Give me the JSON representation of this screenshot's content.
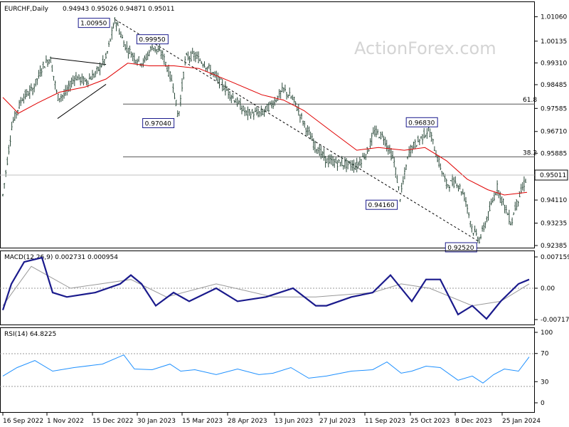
{
  "header": {
    "symbol_label": "EURCHF,Daily",
    "ohlc": "0.94943 0.95026 0.94871 0.95011",
    "watermark": "ActionForex.com"
  },
  "chart_data": [
    {
      "type": "candlestick",
      "title": "EURCHF,Daily",
      "ylim": [
        0.92385,
        1.0121
      ],
      "y_ticks": [
        "1.01060",
        "1.00135",
        "0.99310",
        "0.98485",
        "0.97585",
        "0.96710",
        "0.95885",
        "0.95011",
        "0.94110",
        "0.93235",
        "0.92385"
      ],
      "x_ticks": [
        "16 Sep 2022",
        "1 Nov 2022",
        "15 Dec 2022",
        "30 Jan 2023",
        "15 Mar 2023",
        "28 Apr 2023",
        "13 Jun 2023",
        "27 Jul 2023",
        "11 Sep 2023",
        "25 Oct 2023",
        "8 Dec 2023",
        "25 Jan 2024"
      ],
      "last_price_label": "0.95011",
      "price_path": [
        [
          "2022-09-16",
          0.943
        ],
        [
          "2022-09-25",
          0.97
        ],
        [
          "2022-10-05",
          0.98
        ],
        [
          "2022-10-15",
          0.983
        ],
        [
          "2022-10-25",
          0.992
        ],
        [
          "2022-11-01",
          0.995
        ],
        [
          "2022-11-08",
          0.98
        ],
        [
          "2022-11-15",
          0.981
        ],
        [
          "2022-11-25",
          0.988
        ],
        [
          "2022-12-05",
          0.986
        ],
        [
          "2022-12-15",
          0.989
        ],
        [
          "2022-12-25",
          0.995
        ],
        [
          "2023-01-03",
          1.0095
        ],
        [
          "2023-01-12",
          1.0
        ],
        [
          "2023-01-22",
          0.995
        ],
        [
          "2023-01-30",
          0.993
        ],
        [
          "2023-02-08",
          0.9995
        ],
        [
          "2023-02-18",
          0.996
        ],
        [
          "2023-02-28",
          0.985
        ],
        [
          "2023-03-05",
          0.972
        ],
        [
          "2023-03-12",
          0.995
        ],
        [
          "2023-03-20",
          0.996
        ],
        [
          "2023-03-30",
          0.993
        ],
        [
          "2023-04-10",
          0.988
        ],
        [
          "2023-04-25",
          0.981
        ],
        [
          "2023-05-10",
          0.974
        ],
        [
          "2023-05-25",
          0.974
        ],
        [
          "2023-06-05",
          0.978
        ],
        [
          "2023-06-15",
          0.983
        ],
        [
          "2023-06-25",
          0.979
        ],
        [
          "2023-07-05",
          0.97
        ],
        [
          "2023-07-15",
          0.962
        ],
        [
          "2023-07-27",
          0.956
        ],
        [
          "2023-08-10",
          0.955
        ],
        [
          "2023-08-25",
          0.954
        ],
        [
          "2023-09-05",
          0.96
        ],
        [
          "2023-09-11",
          0.967
        ],
        [
          "2023-09-20",
          0.965
        ],
        [
          "2023-09-30",
          0.956
        ],
        [
          "2023-10-06",
          0.942
        ],
        [
          "2023-10-15",
          0.96
        ],
        [
          "2023-10-25",
          0.964
        ],
        [
          "2023-11-03",
          0.968
        ],
        [
          "2023-11-12",
          0.956
        ],
        [
          "2023-11-20",
          0.947
        ],
        [
          "2023-11-30",
          0.948
        ],
        [
          "2023-12-08",
          0.942
        ],
        [
          "2023-12-15",
          0.93
        ],
        [
          "2023-12-22",
          0.926
        ],
        [
          "2023-12-30",
          0.935
        ],
        [
          "2024-01-08",
          0.946
        ],
        [
          "2024-01-15",
          0.939
        ],
        [
          "2024-01-22",
          0.932
        ],
        [
          "2024-01-25",
          0.938
        ],
        [
          "2024-02-01",
          0.945
        ],
        [
          "2024-02-06",
          0.9501
        ]
      ],
      "moving_average_path": [
        [
          "2022-09-16",
          0.98
        ],
        [
          "2022-10-01",
          0.974
        ],
        [
          "2022-10-20",
          0.978
        ],
        [
          "2022-11-10",
          0.982
        ],
        [
          "2022-12-05",
          0.984
        ],
        [
          "2022-12-25",
          0.987
        ],
        [
          "2023-01-15",
          0.993
        ],
        [
          "2023-02-05",
          0.992
        ],
        [
          "2023-03-01",
          0.992
        ],
        [
          "2023-03-25",
          0.991
        ],
        [
          "2023-04-25",
          0.986
        ],
        [
          "2023-05-25",
          0.981
        ],
        [
          "2023-06-15",
          0.979
        ],
        [
          "2023-07-05",
          0.975
        ],
        [
          "2023-08-01",
          0.967
        ],
        [
          "2023-08-25",
          0.96
        ],
        [
          "2023-09-15",
          0.961
        ],
        [
          "2023-10-10",
          0.96
        ],
        [
          "2023-10-30",
          0.961
        ],
        [
          "2023-11-20",
          0.956
        ],
        [
          "2023-12-10",
          0.949
        ],
        [
          "2023-12-30",
          0.945
        ],
        [
          "2024-01-15",
          0.943
        ],
        [
          "2024-02-06",
          0.944
        ]
      ],
      "price_labels": [
        {
          "date": "2023-01-03",
          "value": 1.0095,
          "label": "1.00950"
        },
        {
          "date": "2023-02-08",
          "value": 0.9995,
          "label": "0.99950"
        },
        {
          "date": "2023-03-05",
          "value": 0.9704,
          "label": "0.97040"
        },
        {
          "date": "2023-11-03",
          "value": 0.9683,
          "label": "0.96830"
        },
        {
          "date": "2023-10-06",
          "value": 0.9416,
          "label": "0.94160"
        },
        {
          "date": "2023-12-22",
          "value": 0.9252,
          "label": "0.92520"
        }
      ],
      "fibonacci": [
        {
          "label": "61.8",
          "value": 0.9775
        },
        {
          "label": "38.2",
          "value": 0.9575
        }
      ],
      "trendlines": [
        {
          "style": "solid",
          "from": [
            "2022-11-01",
            0.995
          ],
          "to": [
            "2022-12-25",
            0.9925
          ]
        },
        {
          "style": "solid",
          "from": [
            "2022-11-08",
            0.972
          ],
          "to": [
            "2022-12-25",
            0.985
          ]
        },
        {
          "style": "dashed",
          "from": [
            "2023-01-03",
            1.0095
          ],
          "to": [
            "2023-12-22",
            0.9252
          ]
        }
      ]
    },
    {
      "type": "line",
      "title": "MACD(12,26,9) 0.002731 0.000954",
      "y_ticks": [
        "0.007159",
        "0.00",
        "-0.007173"
      ],
      "last_value_label": "0.00",
      "series": [
        {
          "name": "MACD",
          "values": [
            [
              0,
              -0.005
            ],
            [
              12,
              0.001
            ],
            [
              30,
              0.006
            ],
            [
              55,
              0.007
            ],
            [
              70,
              -0.001
            ],
            [
              90,
              -0.002
            ],
            [
              130,
              -0.001
            ],
            [
              165,
              0.001
            ],
            [
              180,
              0.003
            ],
            [
              195,
              0.001
            ],
            [
              215,
              -0.004
            ],
            [
              240,
              -0.001
            ],
            [
              262,
              -0.003
            ],
            [
              300,
              0.0
            ],
            [
              330,
              -0.003
            ],
            [
              370,
              -0.002
            ],
            [
              408,
              0.0
            ],
            [
              440,
              -0.004
            ],
            [
              455,
              -0.004
            ],
            [
              490,
              -0.002
            ],
            [
              520,
              -0.001
            ],
            [
              545,
              0.003
            ],
            [
              575,
              -0.003
            ],
            [
              595,
              0.002
            ],
            [
              615,
              0.002
            ],
            [
              640,
              -0.006
            ],
            [
              660,
              -0.004
            ],
            [
              680,
              -0.007
            ],
            [
              700,
              -0.003
            ],
            [
              725,
              0.001
            ],
            [
              740,
              0.002
            ]
          ]
        },
        {
          "name": "Signal",
          "values": [
            [
              0,
              -0.004
            ],
            [
              40,
              0.005
            ],
            [
              95,
              0.0
            ],
            [
              180,
              0.002
            ],
            [
              230,
              -0.002
            ],
            [
              300,
              0.001
            ],
            [
              380,
              -0.002
            ],
            [
              440,
              -0.002
            ],
            [
              520,
              -0.001
            ],
            [
              560,
              0.001
            ],
            [
              600,
              0.0
            ],
            [
              660,
              -0.004
            ],
            [
              700,
              -0.003
            ],
            [
              740,
              0.001
            ]
          ]
        }
      ]
    },
    {
      "type": "line",
      "title": "RSI(14) 64.8225",
      "ylim": [
        0,
        100
      ],
      "y_ticks": [
        "100",
        "70",
        "30",
        "0"
      ],
      "series": [
        {
          "name": "RSI",
          "values": [
            [
              0,
              38
            ],
            [
              20,
              50
            ],
            [
              45,
              60
            ],
            [
              70,
              45
            ],
            [
              100,
              50
            ],
            [
              140,
              55
            ],
            [
              170,
              68
            ],
            [
              185,
              48
            ],
            [
              210,
              47
            ],
            [
              235,
              55
            ],
            [
              250,
              45
            ],
            [
              270,
              47
            ],
            [
              300,
              40
            ],
            [
              330,
              48
            ],
            [
              360,
              40
            ],
            [
              380,
              42
            ],
            [
              405,
              50
            ],
            [
              430,
              35
            ],
            [
              455,
              38
            ],
            [
              490,
              45
            ],
            [
              520,
              47
            ],
            [
              540,
              58
            ],
            [
              560,
              42
            ],
            [
              575,
              45
            ],
            [
              595,
              52
            ],
            [
              615,
              50
            ],
            [
              640,
              32
            ],
            [
              660,
              38
            ],
            [
              675,
              28
            ],
            [
              690,
              40
            ],
            [
              705,
              48
            ],
            [
              725,
              45
            ],
            [
              740,
              65
            ]
          ]
        }
      ]
    }
  ]
}
